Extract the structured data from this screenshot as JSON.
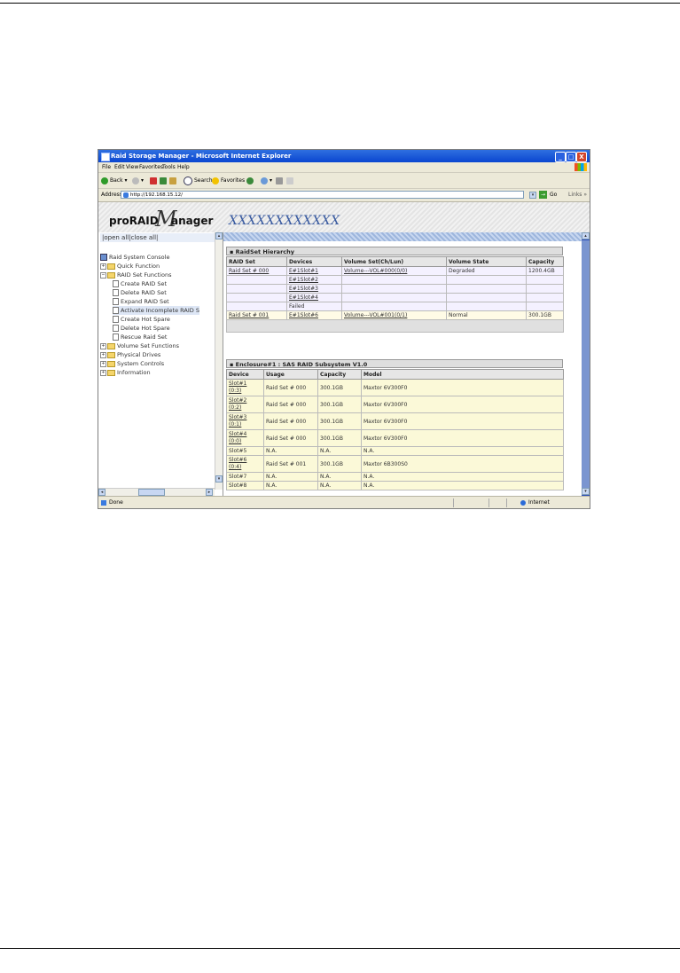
{
  "window": {
    "title": "Raid Storage Manager - Microsoft Internet Explorer",
    "buttons": [
      "_",
      "□",
      "X"
    ]
  },
  "menu": [
    "File",
    "Edit",
    "View",
    "Favorites",
    "Tools",
    "Help"
  ],
  "toolbar": {
    "back": "Back",
    "search": "Search",
    "favorites": "Favorites"
  },
  "address": {
    "label": "Address",
    "url": "http://192.168.15.12/",
    "go": "Go",
    "links": "Links »"
  },
  "banner": {
    "logo_pro": "proRAID",
    "logo_m": "M",
    "logo_anager": "anager",
    "model": "XXXXXXXXXXXX"
  },
  "nav": {
    "open_close": "|open all|close all|",
    "root": "Raid System Console",
    "items": [
      {
        "label": "Quick Function",
        "type": "folder"
      },
      {
        "label": "RAID Set Functions",
        "type": "folder-open"
      },
      {
        "label": "Create RAID Set",
        "type": "page"
      },
      {
        "label": "Delete RAID Set",
        "type": "page"
      },
      {
        "label": "Expand RAID Set",
        "type": "page"
      },
      {
        "label": "Activate Incomplete RAID S",
        "type": "page",
        "selected": true
      },
      {
        "label": "Create Hot Spare",
        "type": "page"
      },
      {
        "label": "Delete Hot Spare",
        "type": "page"
      },
      {
        "label": "Rescue Raid Set",
        "type": "page"
      },
      {
        "label": "Volume Set Functions",
        "type": "folder"
      },
      {
        "label": "Physical Drives",
        "type": "folder"
      },
      {
        "label": "System Controls",
        "type": "folder"
      },
      {
        "label": "Information",
        "type": "folder"
      }
    ]
  },
  "raidset": {
    "heading": "RaidSet Hierarchy",
    "columns": [
      "RAID Set",
      "Devices",
      "Volume Set(Ch/Lun)",
      "Volume State",
      "Capacity"
    ],
    "rows": [
      [
        "Raid Set # 000",
        "E#1Slot#1",
        "Volume---VOL#000(0/0)",
        "Degraded",
        "1200.4GB"
      ],
      [
        "",
        "E#1Slot#2",
        "",
        "",
        ""
      ],
      [
        "",
        "E#1Slot#3",
        "",
        "",
        ""
      ],
      [
        "",
        "E#1Slot#4",
        "",
        "",
        ""
      ],
      [
        "",
        "Failed",
        "",
        "",
        ""
      ],
      [
        "Raid Set # 001",
        "E#1Slot#6",
        "Volume---VOL#001(0/1)",
        "Normal",
        "300.1GB"
      ]
    ]
  },
  "enclosure": {
    "heading": "Enclosure#1 : SAS RAID Subsystem V1.0",
    "columns": [
      "Device",
      "Usage",
      "Capacity",
      "Model"
    ],
    "rows": [
      {
        "slot": "Slot#1",
        "port": "(0:3)",
        "usage": "Raid Set # 000",
        "capacity": "300.1GB",
        "model": "Maxtor 6V300F0",
        "active": true
      },
      {
        "slot": "Slot#2",
        "port": "(0:2)",
        "usage": "Raid Set # 000",
        "capacity": "300.1GB",
        "model": "Maxtor 6V300F0",
        "active": true
      },
      {
        "slot": "Slot#3",
        "port": "(0:1)",
        "usage": "Raid Set # 000",
        "capacity": "300.1GB",
        "model": "Maxtor 6V300F0",
        "active": true
      },
      {
        "slot": "Slot#4",
        "port": "(0:0)",
        "usage": "Raid Set # 000",
        "capacity": "300.1GB",
        "model": "Maxtor 6V300F0",
        "active": true
      },
      {
        "slot": "Slot#5",
        "port": "",
        "usage": "N.A.",
        "capacity": "N.A.",
        "model": "N.A.",
        "active": false
      },
      {
        "slot": "Slot#6",
        "port": "(0:4)",
        "usage": "Raid Set # 001",
        "capacity": "300.1GB",
        "model": "Maxtor 6B300S0",
        "active": true
      },
      {
        "slot": "Slot#7",
        "port": "",
        "usage": "N.A.",
        "capacity": "N.A.",
        "model": "N.A.",
        "active": false
      },
      {
        "slot": "Slot#8",
        "port": "",
        "usage": "N.A.",
        "capacity": "N.A.",
        "model": "N.A.",
        "active": false
      }
    ]
  },
  "status": {
    "left": "Done",
    "zone": "Internet"
  },
  "colors": {
    "titlebar": "#0a46d0",
    "degraded": "#d03030",
    "normal": "#d03030",
    "model_text": "#3a5ba0"
  }
}
